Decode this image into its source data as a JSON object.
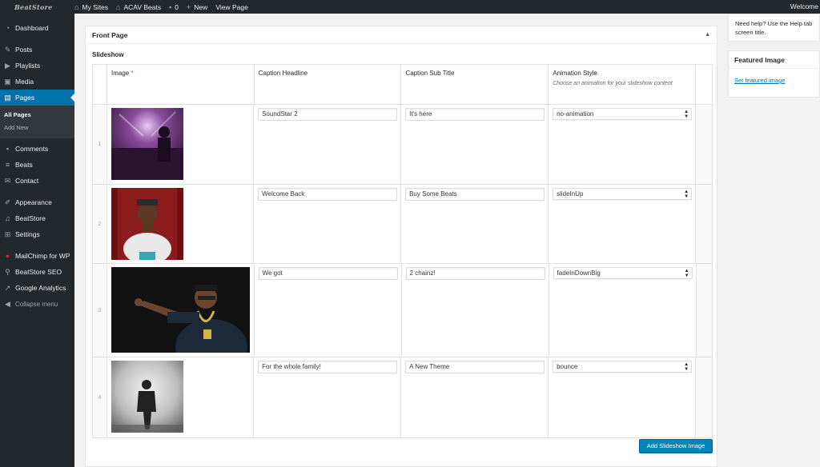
{
  "admin_bar": {
    "logo": "BeatStore",
    "my_sites": "My Sites",
    "site_name": "ACAV Beats",
    "comments_count": "0",
    "new": "New",
    "view_page": "View Page",
    "welcome": "Welcome"
  },
  "sidebar": {
    "dashboard": "Dashboard",
    "posts": "Posts",
    "playlists": "Playlists",
    "media": "Media",
    "pages": "Pages",
    "all_pages": "All Pages",
    "add_new": "Add New",
    "comments": "Comments",
    "beats": "Beats",
    "contact": "Contact",
    "appearance": "Appearance",
    "beatstore": "BeatStore",
    "settings": "Settings",
    "mailchimp": "MailChimp for WP",
    "beatstore_seo": "BeatStore SEO",
    "google_analytics": "Google Analytics",
    "collapse": "Collapse menu"
  },
  "panel": {
    "title": "Front Page",
    "section": "Slideshow",
    "headers": {
      "image": "Image",
      "required": "*",
      "caption_headline": "Caption Headline",
      "caption_sub": "Caption Sub Title",
      "animation": "Animation Style",
      "animation_desc": "Choose an animation for your slideshow content"
    },
    "rows": [
      {
        "num": "1",
        "headline": "SoundStar 2",
        "sub": "It's here",
        "animation": "no-animation"
      },
      {
        "num": "2",
        "headline": "Welcome Back",
        "sub": "Buy Some Beats",
        "animation": "slideInUp"
      },
      {
        "num": "3",
        "headline": "We got",
        "sub": "2 chainz!",
        "animation": "fadeInDownBig"
      },
      {
        "num": "4",
        "headline": "For the whole family!",
        "sub": "A New Theme",
        "animation": "bounce"
      }
    ],
    "add_button": "Add Slideshow Image"
  },
  "help": {
    "text": "Need help? Use the Help tab screen title."
  },
  "featured": {
    "title": "Featured Image",
    "link": "Set featured image"
  },
  "colors": {
    "admin_dark": "#23282d",
    "accent": "#0073aa",
    "button": "#0085ba"
  }
}
